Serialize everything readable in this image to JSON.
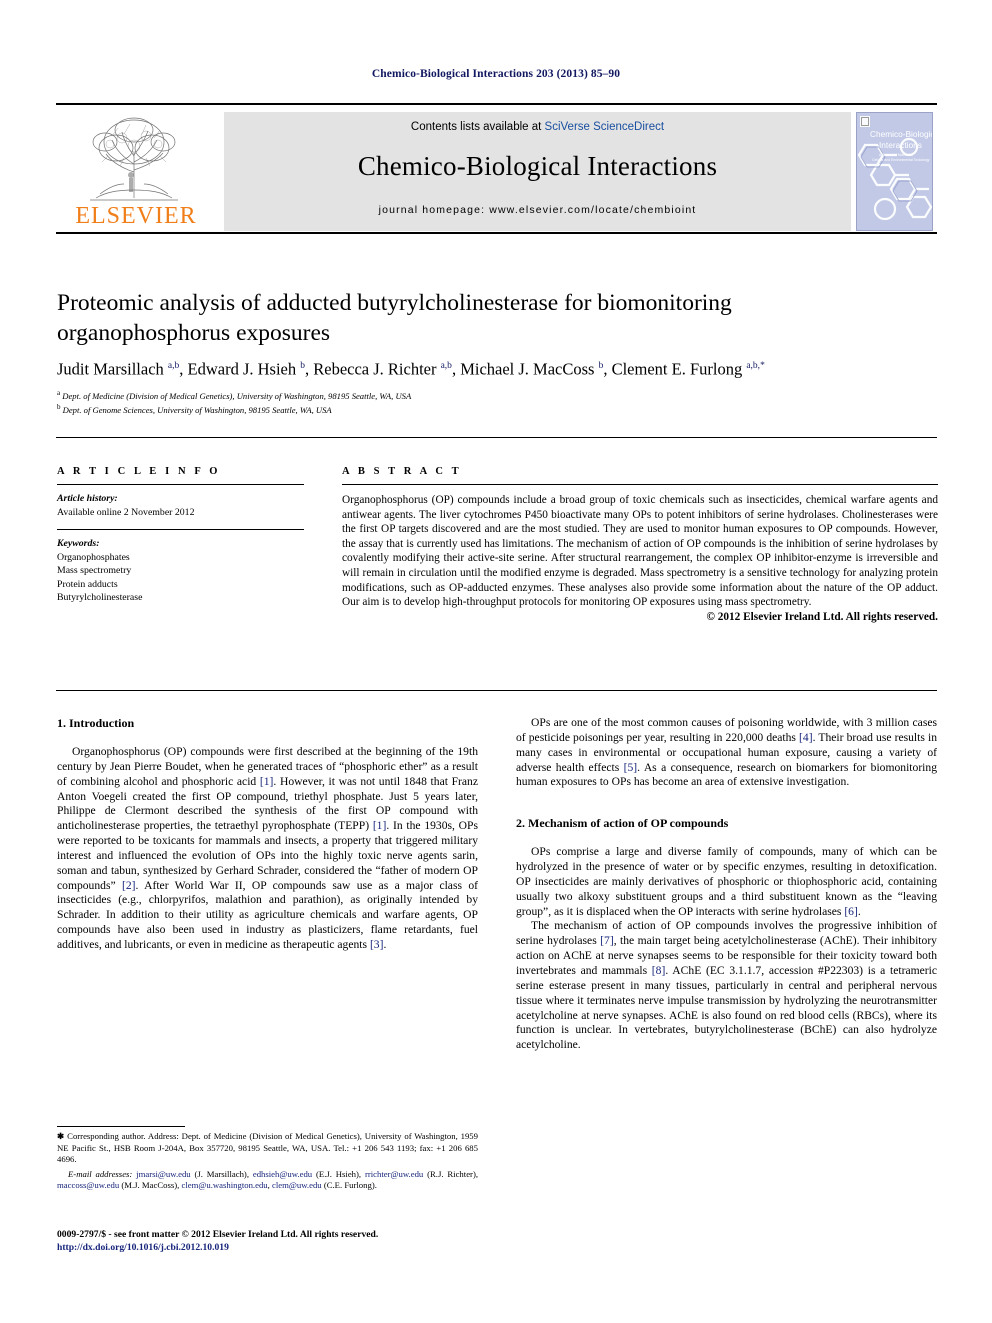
{
  "running_head": "Chemico-Biological Interactions 203 (2013) 85–90",
  "masthead": {
    "publisher_wordmark": "ELSEVIER",
    "publisher_logo_icon": "elsevier-tree-icon",
    "contents_prefix": "Contents lists available at ",
    "contents_link": "SciVerse ScienceDirect",
    "journal_name": "Chemico-Biological Interactions",
    "homepage_line": "journal homepage: www.elsevier.com/locate/chembioint",
    "cover_title_line1": "Chemico-Biological",
    "cover_title_line2": "Interactions",
    "cover_subtitle": "A Journal of Molecular, Cellular and Environmental Toxicology",
    "link_color": "#1a4fa0",
    "brand_orange": "#f07e19",
    "band_grey": "#e3e3e3"
  },
  "article": {
    "title": "Proteomic analysis of adducted butyrylcholinesterase for biomonitoring organophosphorus exposures",
    "authors_html": "Judit Marsillach <sup>a,b</sup>, Edward J. Hsieh <sup>b</sup>, Rebecca J. Richter <sup>a,b</sup>, Michael J. MacCoss <sup>b</sup>, Clement E. Furlong <sup>a,b,</sup><sup>*</sup>",
    "affiliation_a": "Dept. of Medicine (Division of Medical Genetics), University of Washington, 98195 Seattle, WA, USA",
    "affiliation_b": "Dept. of Genome Sciences, University of Washington, 98195 Seattle, WA, USA"
  },
  "article_info": {
    "heading": "A R T I C L E    I N F O",
    "history_label": "Article history:",
    "history_value": "Available online 2 November 2012",
    "keywords_label": "Keywords:",
    "keywords": [
      "Organophosphates",
      "Mass spectrometry",
      "Protein adducts",
      "Butyrylcholinesterase"
    ]
  },
  "abstract": {
    "heading": "A B S T R A C T",
    "body": "Organophosphorus (OP) compounds include a broad group of toxic chemicals such as insecticides, chemical warfare agents and antiwear agents. The liver cytochromes P450 bioactivate many OPs to potent inhibitors of serine hydrolases. Cholinesterases were the first OP targets discovered and are the most studied. They are used to monitor human exposures to OP compounds. However, the assay that is currently used has limitations. The mechanism of action of OP compounds is the inhibition of serine hydrolases by covalently modifying their active-site serine. After structural rearrangement, the complex OP inhibitor-enzyme is irreversible and will remain in circulation until the modified enzyme is degraded. Mass spectrometry is a sensitive technology for analyzing protein modifications, such as OP-adducted enzymes. These analyses also provide some information about the nature of the OP adduct. Our aim is to develop high-throughput protocols for monitoring OP exposures using mass spectrometry.",
    "copyright": "© 2012 Elsevier Ireland Ltd. All rights reserved."
  },
  "body": {
    "section1_heading": "1. Introduction",
    "section1_p1_html": "Organophosphorus (OP) compounds were first described at the beginning of the 19th century by Jean Pierre Boudet, when he generated traces of “phosphoric ether” as a result of combining alcohol and phosphoric acid <span class=\"ref\">[1]</span>. However, it was not until 1848 that Franz Anton Voegeli created the first OP compound, triethyl phosphate. Just 5 years later, Philippe de Clermont described the synthesis of the first OP compound with anticholinesterase properties, the tetraethyl pyrophosphate (TEPP) <span class=\"ref\">[1]</span>. In the 1930s, OPs were reported to be toxicants for mammals and insects, a property that triggered military interest and influenced the evolution of OPs into the highly toxic nerve agents sarin, soman and tabun, synthesized by Gerhard Schrader, considered the “father of modern OP compounds” <span class=\"ref\">[2]</span>. After World War II, OP compounds saw use as a major class of insecticides (e.g., chlorpyrifos, malathion and parathion), as originally intended by Schrader. In addition to their utility as agriculture chemicals and warfare agents, OP compounds have also been used in industry as plasticizers, flame retardants, fuel additives, and lubricants, or even in medicine as therapeutic agents <span class=\"ref\">[3]</span>.",
    "section1_p2_html": "OPs are one of the most common causes of poisoning worldwide, with 3 million cases of pesticide poisonings per year, resulting in 220,000 deaths <span class=\"ref\">[4]</span>. Their broad use results in many cases in environmental or occupational human exposure, causing a variety of adverse health effects <span class=\"ref\">[5]</span>. As a consequence, research on biomarkers for biomonitoring human exposures to OPs has become an area of extensive investigation.",
    "section2_heading": "2. Mechanism of action of OP compounds",
    "section2_p1_html": "OPs comprise a large and diverse family of compounds, many of which can be hydrolyzed in the presence of water or by specific enzymes, resulting in detoxification. OP insecticides are mainly derivatives of phosphoric or thiophosphoric acid, containing usually two alkoxy substituent groups and a third substituent known as the “leaving group”, as it is displaced when the OP interacts with serine hydrolases <span class=\"ref\">[6]</span>.",
    "section2_p2_html": "The mechanism of action of OP compounds involves the progressive inhibition of serine hydrolases <span class=\"ref\">[7]</span>, the main target being acetylcholinesterase (AChE). Their inhibitory action on AChE at nerve synapses seems to be responsible for their toxicity toward both invertebrates and mammals <span class=\"ref\">[8]</span>. AChE (EC 3.1.1.7, accession #P22303) is a tetrameric serine esterase present in many tissues, particularly in central and peripheral nervous tissue where it terminates nerve impulse transmission by hydrolyzing the neurotransmitter acetylcholine at nerve synapses. AChE is also found on red blood cells (RBCs), where its function is unclear. In vertebrates, butyrylcholinesterase (BChE) can also hydrolyze acetylcholine."
  },
  "footnotes": {
    "corresponding_html": "<span style=\"font-weight:bold;\">&#10033;</span> Corresponding author. Address: Dept. of Medicine (Division of Medical Genetics), University of Washington, 1959 NE Pacific St., HSB Room J-204A, Box 357720, 98195 Seattle, WA, USA. Tel.: +1 206 543 1193; fax: +1 206 685 4696.",
    "email_html": "<span class=\"em-label\">E-mail addresses:</span> <span class=\"mail\">jmarsi@uw.edu</span> (J. Marsillach), <span class=\"mail\">edhsieh@uw.edu</span> (E.J. Hsieh), <span class=\"mail\">rrichter@uw.edu</span> (R.J. Richter), <span class=\"mail\">maccoss@uw.edu</span> (M.J. MacCoss), <span class=\"mail\">clem@u.washington.edu</span>, <span class=\"mail\">clem@uw.edu</span> (C.E. Furlong)."
  },
  "imprint": {
    "issn_line": "0009-2797/$ - see front matter © 2012 Elsevier Ireland Ltd. All rights reserved.",
    "doi": "http://dx.doi.org/10.1016/j.cbi.2012.10.019"
  }
}
